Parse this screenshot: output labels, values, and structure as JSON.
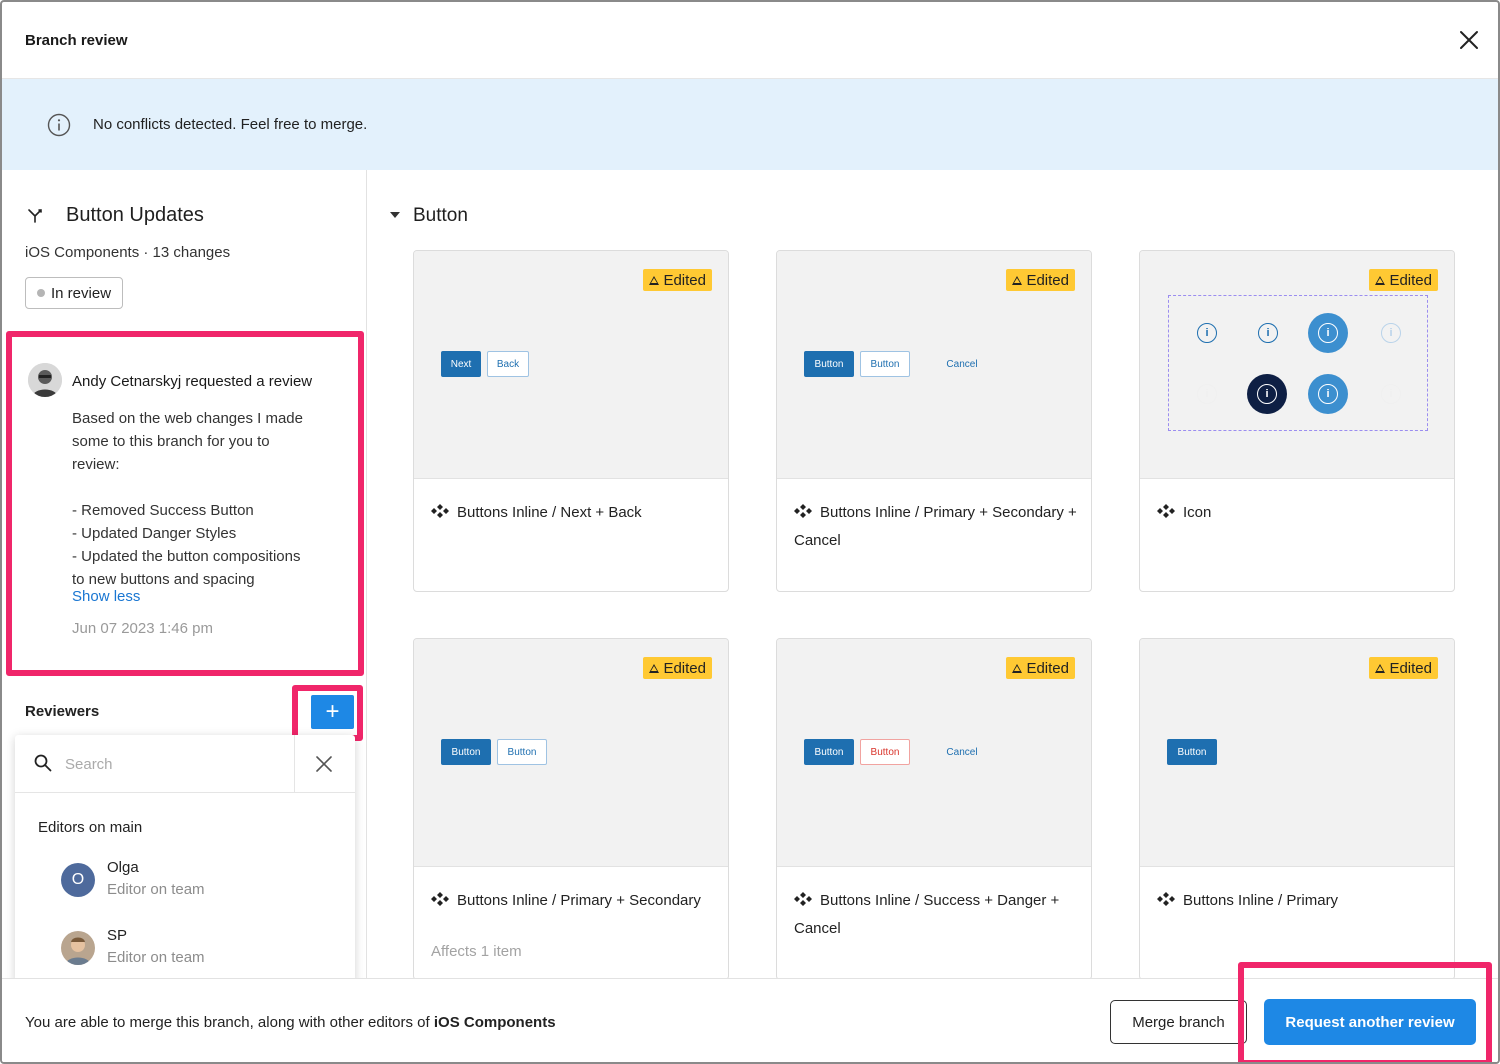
{
  "header": {
    "title": "Branch review",
    "close_icon": "close-icon"
  },
  "banner": {
    "icon": "info-icon",
    "text": "No conflicts detected. Feel free to merge.",
    "color": "#e3f1fc"
  },
  "branch": {
    "icon": "branch-icon",
    "name": "Button Updates",
    "subtitle": "iOS Components · 13 changes",
    "status": "In review"
  },
  "request": {
    "author_line": "Andy Cetnarskyj requested a review",
    "body": [
      "Based on the web changes I made",
      "some to this branch for you to",
      "review:",
      "",
      "- Removed Success Button",
      "- Updated Danger Styles",
      "- Updated the button compositions",
      "to new buttons and spacing"
    ],
    "toggle": "Show less",
    "date": "Jun 07 2023 1:46 pm"
  },
  "reviewers": {
    "label": "Reviewers",
    "add_label": "+",
    "search": {
      "value": "",
      "placeholder": "Search"
    },
    "group_label": "Editors on main",
    "people": [
      {
        "name": "Olga",
        "role": "Editor on team",
        "initial": "O",
        "color": "#4e6a9c"
      },
      {
        "name": "SP",
        "role": "Editor on team",
        "initial": "",
        "color": "#c9a98a"
      }
    ]
  },
  "section": {
    "title": "Button"
  },
  "cards": [
    {
      "name": "Buttons Inline / Next + Back",
      "badge": "Edited",
      "affects": "",
      "buttons": [
        "Next",
        "Back"
      ]
    },
    {
      "name": "Buttons Inline / Primary + Secondary + Cancel",
      "badge": "Edited",
      "affects": "",
      "buttons": [
        "Button",
        "Button",
        "Cancel"
      ]
    },
    {
      "name": "Icon",
      "badge": "Edited",
      "affects": ""
    },
    {
      "name": "Buttons Inline / Primary + Secondary",
      "badge": "Edited",
      "affects": "Affects 1 item",
      "buttons": [
        "Button",
        "Button"
      ]
    },
    {
      "name": "Buttons Inline / Success + Danger + Cancel",
      "badge": "Edited",
      "affects": "",
      "buttons": [
        "Button",
        "Button",
        "Cancel"
      ]
    },
    {
      "name": "Buttons Inline / Primary",
      "badge": "Edited",
      "affects": "",
      "buttons": [
        "Button"
      ]
    }
  ],
  "footer": {
    "message_prefix": "You are able to merge this branch, along with other editors of ",
    "message_file": "iOS Components",
    "merge_label": "Merge branch",
    "request_label": "Request another review"
  },
  "colors": {
    "accent": "#1e88e5",
    "highlight": "#f0266a",
    "badge": "#ffc933",
    "primary_button": "#1e6fb0"
  }
}
